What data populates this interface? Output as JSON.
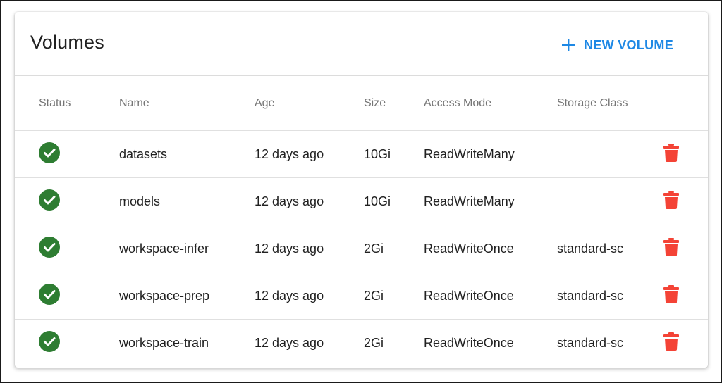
{
  "header": {
    "title": "Volumes",
    "new_button_label": "NEW VOLUME",
    "new_button_icon": "plus-icon",
    "accent_color": "#1e88e5"
  },
  "table": {
    "columns": {
      "status": "Status",
      "name": "Name",
      "age": "Age",
      "size": "Size",
      "access_mode": "Access Mode",
      "storage_class": "Storage Class"
    },
    "rows": [
      {
        "status": "ready",
        "status_icon": "check-circle-icon",
        "name": "datasets",
        "age": "12 days ago",
        "size": "10Gi",
        "access_mode": "ReadWriteMany",
        "storage_class": "",
        "delete_icon": "trash-icon"
      },
      {
        "status": "ready",
        "status_icon": "check-circle-icon",
        "name": "models",
        "age": "12 days ago",
        "size": "10Gi",
        "access_mode": "ReadWriteMany",
        "storage_class": "",
        "delete_icon": "trash-icon"
      },
      {
        "status": "ready",
        "status_icon": "check-circle-icon",
        "name": "workspace-infer",
        "age": "12 days ago",
        "size": "2Gi",
        "access_mode": "ReadWriteOnce",
        "storage_class": "standard-sc",
        "delete_icon": "trash-icon"
      },
      {
        "status": "ready",
        "status_icon": "check-circle-icon",
        "name": "workspace-prep",
        "age": "12 days ago",
        "size": "2Gi",
        "access_mode": "ReadWriteOnce",
        "storage_class": "standard-sc",
        "delete_icon": "trash-icon"
      },
      {
        "status": "ready",
        "status_icon": "check-circle-icon",
        "name": "workspace-train",
        "age": "12 days ago",
        "size": "2Gi",
        "access_mode": "ReadWriteOnce",
        "storage_class": "standard-sc",
        "delete_icon": "trash-icon"
      }
    ]
  },
  "colors": {
    "status_ok": "#2e7d32",
    "delete": "#f44336"
  }
}
